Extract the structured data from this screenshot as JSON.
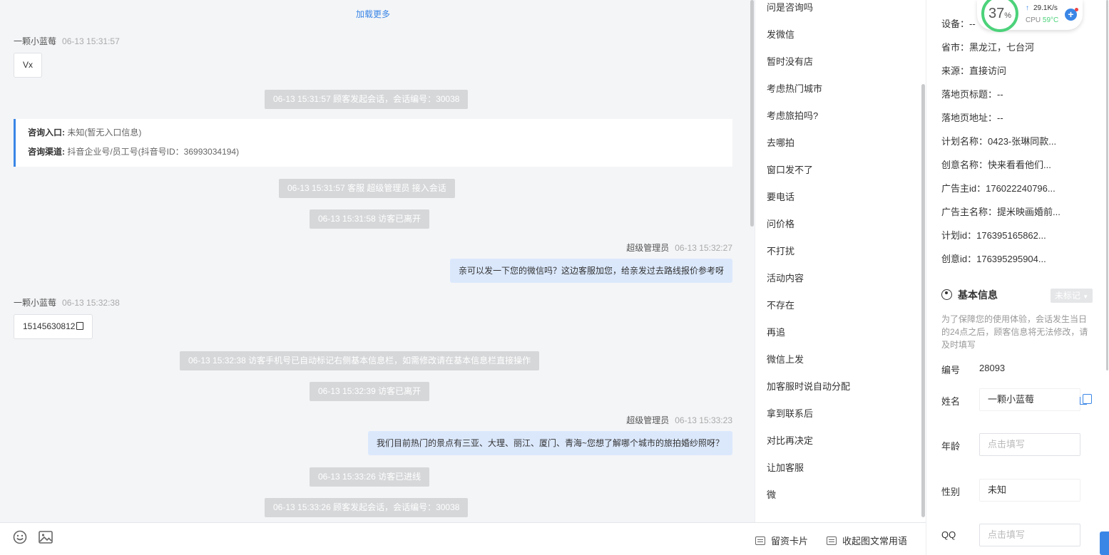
{
  "chat": {
    "load_more": "加载更多",
    "messages": [
      {
        "sender": "一颗小蓝莓",
        "time": "06-13 15:31:57",
        "text": "Vx"
      },
      {
        "system": "06-13 15:31:57 顾客发起会话，会话编号：30038"
      },
      {
        "entry_label": "咨询入口:",
        "entry_value": "未知(暂无入口信息)",
        "channel_label": "咨询渠道:",
        "channel_value": "抖音企业号/员工号(抖音号ID：36993034194)"
      },
      {
        "system": "06-13 15:31:57 客服 超级管理员 接入会话"
      },
      {
        "system": "06-13 15:31:58 访客已离开"
      },
      {
        "sender": "超级管理员",
        "time": "06-13 15:32:27",
        "text": "亲可以发一下您的微信吗？这边客服加您，给亲发过去路线报价参考呀"
      },
      {
        "sender": "一颗小蓝莓",
        "time": "06-13 15:32:38",
        "text": "15145630812"
      },
      {
        "system": "06-13 15:32:38 访客手机号已自动标记右侧基本信息栏，如需修改请在基本信息栏直接操作"
      },
      {
        "system": "06-13 15:32:39 访客已离开"
      },
      {
        "sender": "超级管理员",
        "time": "06-13 15:33:23",
        "text": "我们目前热门的景点有三亚、大理、丽江、厦门、青海~您想了解哪个城市的旅拍婚纱照呀？"
      },
      {
        "system": "06-13 15:33:26 访客已进线"
      },
      {
        "system": "06-13 15:33:26 顾客发起会话，会话编号：30038"
      }
    ]
  },
  "toolbar": {
    "emoji_icon": "smile-icon",
    "image_icon": "image-icon",
    "card_label": "留资卡片",
    "collapse_label": "收起图文常用语"
  },
  "quick_replies": [
    "问是咨询吗",
    "发微信",
    "暂时没有店",
    "考虑热门城市",
    "考虑旅拍吗?",
    "去哪拍",
    "窗口发不了",
    "要电话",
    "问价格",
    "不打扰",
    "活动内容",
    "不存在",
    "再追",
    "微信上发",
    "加客服时说自动分配",
    "拿到联系后",
    "对比再决定",
    "让加客服",
    "微"
  ],
  "info": {
    "device": "设备：--",
    "province": "省市：黑龙江，七台河",
    "source": "来源：直接访问",
    "landing_title": "落地页标题：--",
    "landing_url": "落地页地址：--",
    "plan_name": "计划名称：0423-张琳同款...",
    "creative_name": "创意名称：快来看看他们...",
    "advertiser_id": "广告主id：176022240796...",
    "advertiser_name": "广告主名称：提米映画婚前...",
    "plan_id": "计划id：176395165862...",
    "creative_id": "创意id：176395295904...",
    "basic_title": "基本信息",
    "mark_label": "未标记",
    "notice": "为了保障您的使用体验，会话发生当日的24点之后，顾客信息将无法修改，请及时填写",
    "fields": {
      "id_label": "编号",
      "id_value": "28093",
      "name_label": "姓名",
      "name_value": "一颗小蓝莓",
      "age_label": "年龄",
      "age_placeholder": "点击填写",
      "gender_label": "性别",
      "gender_value": "未知",
      "qq_label": "QQ",
      "qq_placeholder": "点击填写"
    }
  },
  "cpu_widget": {
    "percent": "37",
    "percent_unit": "%",
    "speed": "29.1K/s",
    "cpu_label": "CPU",
    "temp": "59°C"
  },
  "colors": {
    "accent": "#3a86e6",
    "bubble_right": "#dbe8fc",
    "system_bg": "#d6d7d9",
    "ok_green": "#4cd27a"
  }
}
